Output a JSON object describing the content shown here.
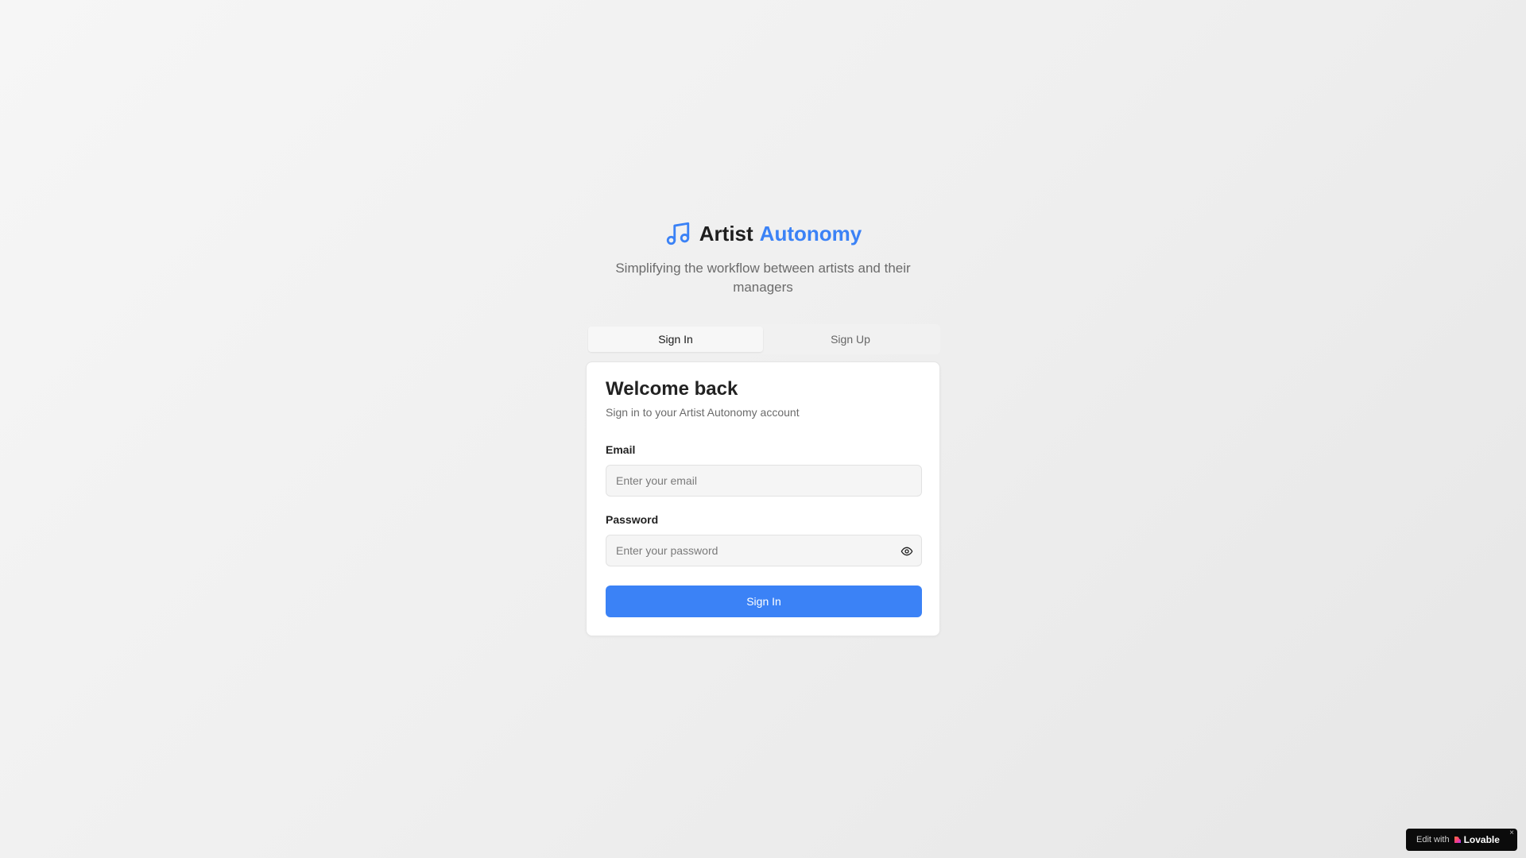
{
  "brand": {
    "word1": "Artist",
    "word2": "Autonomy",
    "icon": "music-icon",
    "accent_color": "#3b82f6"
  },
  "tagline": "Simplifying the workflow between artists and their managers",
  "tabs": [
    {
      "label": "Sign In",
      "active": true
    },
    {
      "label": "Sign Up",
      "active": false
    }
  ],
  "card": {
    "title": "Welcome back",
    "subtitle": "Sign in to your Artist Autonomy account",
    "email": {
      "label": "Email",
      "placeholder": "Enter your email",
      "value": ""
    },
    "password": {
      "label": "Password",
      "placeholder": "Enter your password",
      "value": "",
      "toggle_icon": "eye-icon"
    },
    "submit_label": "Sign In",
    "submit_color": "#3b82f6"
  },
  "badge": {
    "prefix": "Edit with",
    "brand": "Lovable",
    "close": "×"
  }
}
